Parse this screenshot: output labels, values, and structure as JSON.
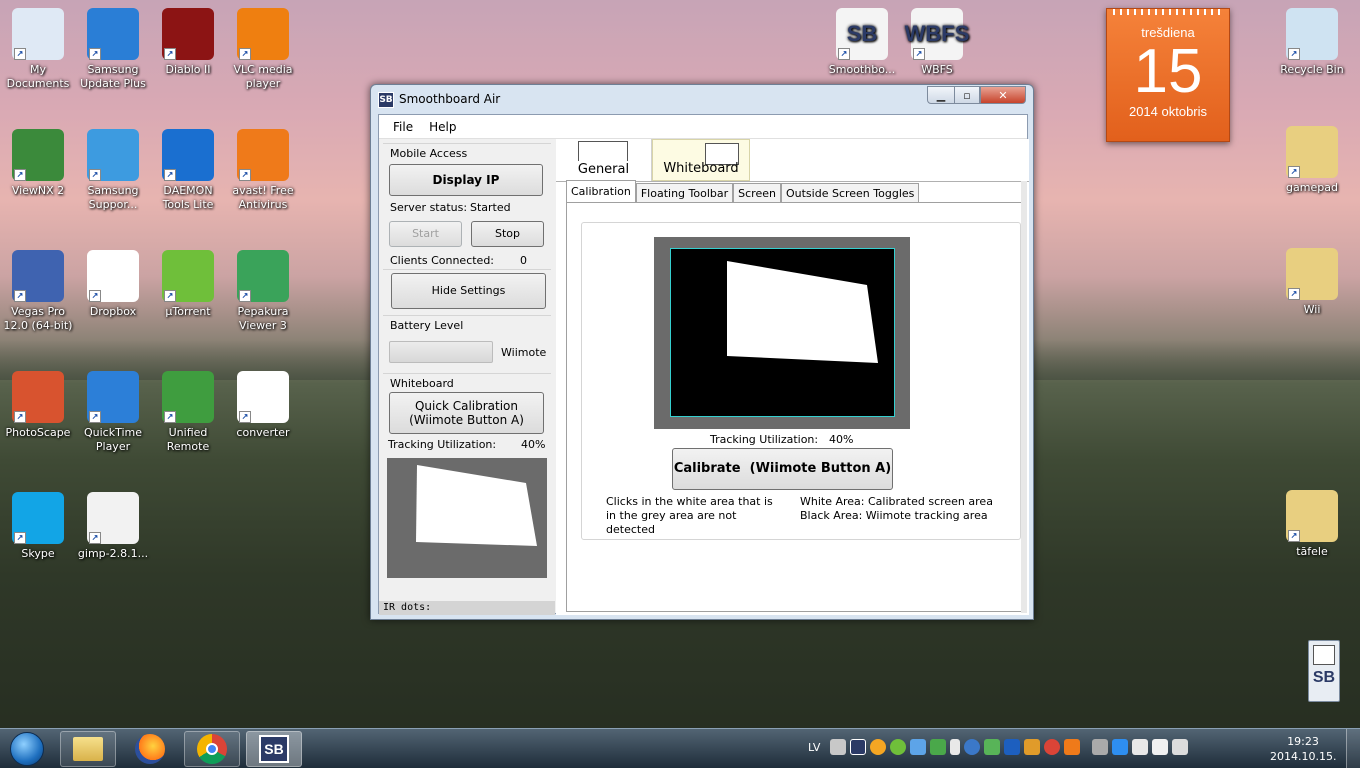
{
  "desktop": {
    "icons_left": [
      {
        "label": "My Documents",
        "color": "#dfe9f5"
      },
      {
        "label": "Samsung Update Plus",
        "color": "#2a7ed6"
      },
      {
        "label": "Diablo II",
        "color": "#8c1414"
      },
      {
        "label": "VLC media player",
        "color": "#ef7f10"
      },
      {
        "label": "ViewNX 2",
        "color": "#3b8a3b"
      },
      {
        "label": "Samsung Suppor...",
        "color": "#3d9be0"
      },
      {
        "label": "DAEMON Tools Lite",
        "color": "#1a6fd0"
      },
      {
        "label": "avast! Free Antivirus",
        "color": "#ef7a1a"
      },
      {
        "label": "Vegas Pro 12.0 (64-bit)",
        "color": "#3f63b0"
      },
      {
        "label": "Dropbox",
        "color": "#ffffff"
      },
      {
        "label": "µTorrent",
        "color": "#6fbf3a"
      },
      {
        "label": "Pepakura Viewer 3",
        "color": "#3aa35a"
      },
      {
        "label": "PhotoScape",
        "color": "#d8532f"
      },
      {
        "label": "QuickTime Player",
        "color": "#2c7fd8"
      },
      {
        "label": "Unified Remote",
        "color": "#3f9d3f"
      },
      {
        "label": "converter",
        "color": "#ffffff"
      },
      {
        "label": "Skype",
        "color": "#12a5e6"
      },
      {
        "label": "gimp-2.8.1...",
        "color": "#f2f2f2"
      }
    ],
    "icons_top": [
      {
        "label": "Smoothbo...",
        "glyph": "SB"
      },
      {
        "label": "WBFS",
        "glyph": "WBFS"
      }
    ],
    "icons_right": [
      {
        "label": "Recycle Bin"
      },
      {
        "label": "gamepad"
      },
      {
        "label": "Wii"
      },
      {
        "label": "tāfele"
      }
    ],
    "calendar": {
      "weekday": "trešdiena",
      "day": "15",
      "month": "2014 oktobris"
    },
    "sb_widget": "SB"
  },
  "window": {
    "title": "Smoothboard Air",
    "icon_glyph": "SB",
    "menu": [
      "File",
      "Help"
    ],
    "mobile_access": {
      "group_title": "Mobile Access",
      "display_ip": "Display IP",
      "server_status_label": "Server status:",
      "server_status_value": "Started",
      "start": "Start",
      "stop": "Stop",
      "clients_label": "Clients Connected:",
      "clients_value": "0"
    },
    "hide_settings": "Hide Settings",
    "battery": {
      "group_title": "Battery Level",
      "device": "Wiimote",
      "level": 0
    },
    "whiteboard": {
      "group_title": "Whiteboard",
      "quick_cal": "Quick Calibration (Wiimote Button A)",
      "tracking_label": "Tracking Utilization:",
      "tracking_value": "40%"
    },
    "status_bar": "IR dots:",
    "big_tabs": [
      "General",
      "Whiteboard"
    ],
    "small_tabs": [
      "Calibration",
      "Floating Toolbar",
      "Screen",
      "Outside Screen Toggles"
    ],
    "calibration": {
      "tracking_label": "Tracking Utilization:",
      "tracking_value": "40%",
      "button": "Calibrate  (Wiimote Button A)",
      "note_left": "Clicks in the white area that is in the grey area are not detected",
      "note_right_1": "White Area: Calibrated screen area",
      "note_right_2": "Black Area: Wiimote tracking area"
    }
  },
  "taskbar": {
    "language": "LV",
    "time": "19:23",
    "date": "2014.10.15.",
    "pinned": [
      "explorer",
      "firefox",
      "chrome",
      "smoothboard"
    ],
    "active_glyph": "SB"
  }
}
